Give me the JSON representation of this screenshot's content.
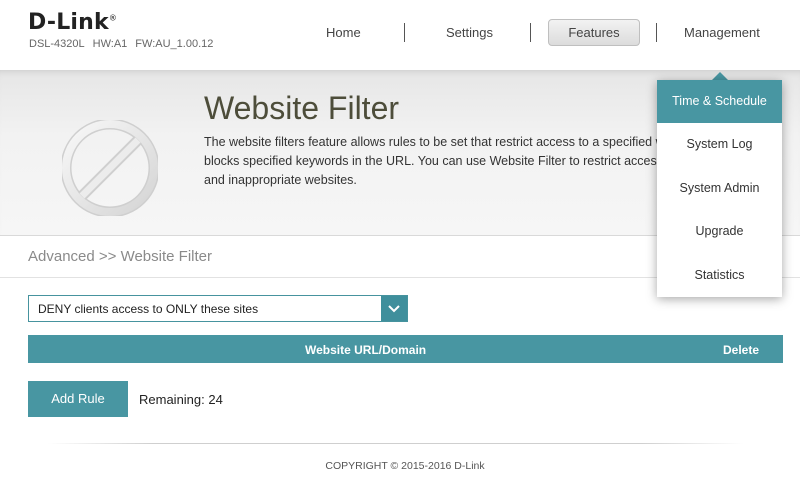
{
  "header": {
    "logo": "D-Link",
    "logo_mark": "®",
    "model": "DSL-4320L",
    "hw": "HW:A1",
    "fw": "FW:AU_1.00.12"
  },
  "nav": {
    "home": "Home",
    "settings": "Settings",
    "features": "Features",
    "management": "Management"
  },
  "banner": {
    "title": "Website Filter",
    "description_lines": [
      "The website filters feature allows rules to be set that restrict access to a specified w",
      "blocks specified keywords in the URL. You can use Website Filter to restrict access",
      "and inappropriate websites."
    ]
  },
  "breadcrumb": "Advanced >> Website Filter",
  "filter_select": {
    "value": "DENY clients access to ONLY these sites"
  },
  "table": {
    "columns": [
      "Website URL/Domain",
      "Delete"
    ]
  },
  "add_rule_label": "Add Rule",
  "remaining": "Remaining: 24",
  "footer": {
    "copyright": "COPYRIGHT © 2015-2016 D-Link"
  },
  "management_menu": {
    "items": [
      {
        "label": "Time & Schedule",
        "active": true
      },
      {
        "label": "System Log"
      },
      {
        "label": "System Admin"
      },
      {
        "label": "Upgrade"
      },
      {
        "label": "Statistics"
      }
    ]
  },
  "colors": {
    "accent": "#4896a2",
    "banner_bg": "#f0f0f0"
  },
  "icons": {
    "banner": "no-entry-icon",
    "select_arrow": "chevron-down-icon"
  }
}
